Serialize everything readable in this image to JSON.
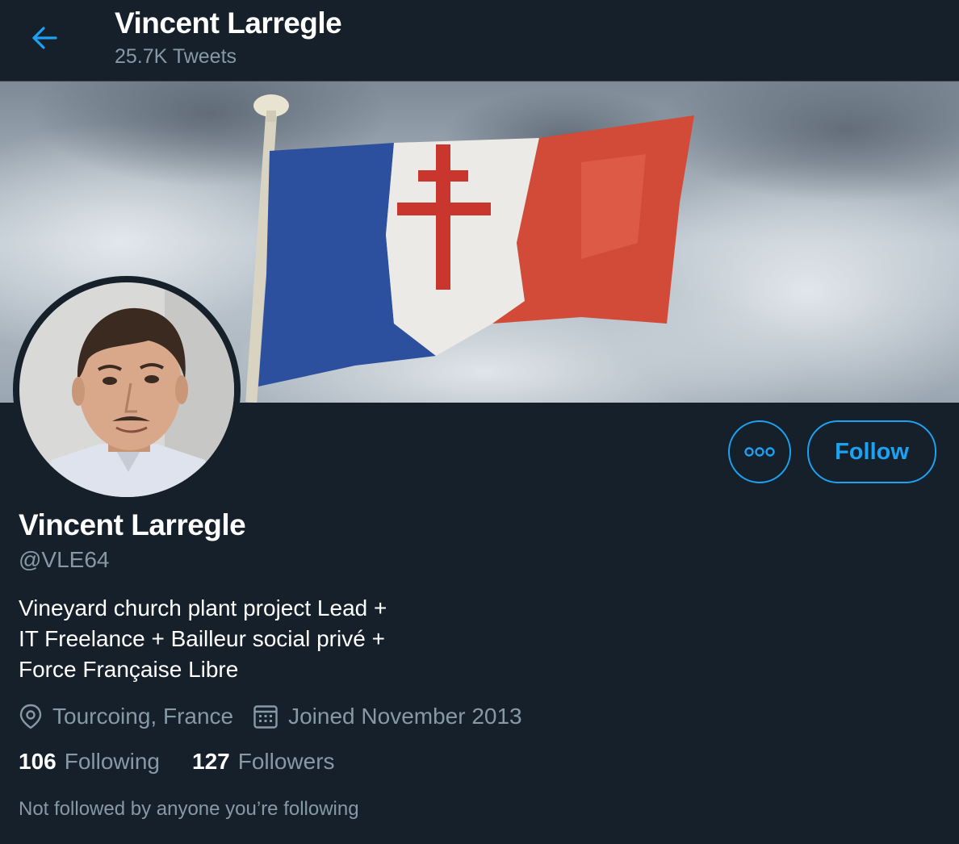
{
  "colors": {
    "background": "#15202b",
    "accent": "#1da1f2",
    "secondary_text": "#8899a6",
    "primary_text": "#ffffff"
  },
  "header": {
    "back_icon": "arrow-left-icon",
    "title": "Vincent Larregle",
    "tweet_count": "25.7K Tweets"
  },
  "banner": {
    "icon": "banner-image-flag"
  },
  "profile": {
    "display_name": "Vincent Larregle",
    "handle": "@VLE64",
    "bio_lines": [
      "Vineyard church plant project Lead +",
      "IT Freelance + Bailleur social privé +",
      "Force Française Libre"
    ],
    "location_icon": "location-pin-icon",
    "location": "Tourcoing, France",
    "joined_icon": "calendar-icon",
    "joined": "Joined November 2013",
    "following_count": "106",
    "following_label": "Following",
    "followers_count": "127",
    "followers_label": "Followers",
    "followed_by_note": "Not followed by anyone you’re following"
  },
  "actions": {
    "more_icon": "more-options-icon",
    "follow_label": "Follow"
  }
}
